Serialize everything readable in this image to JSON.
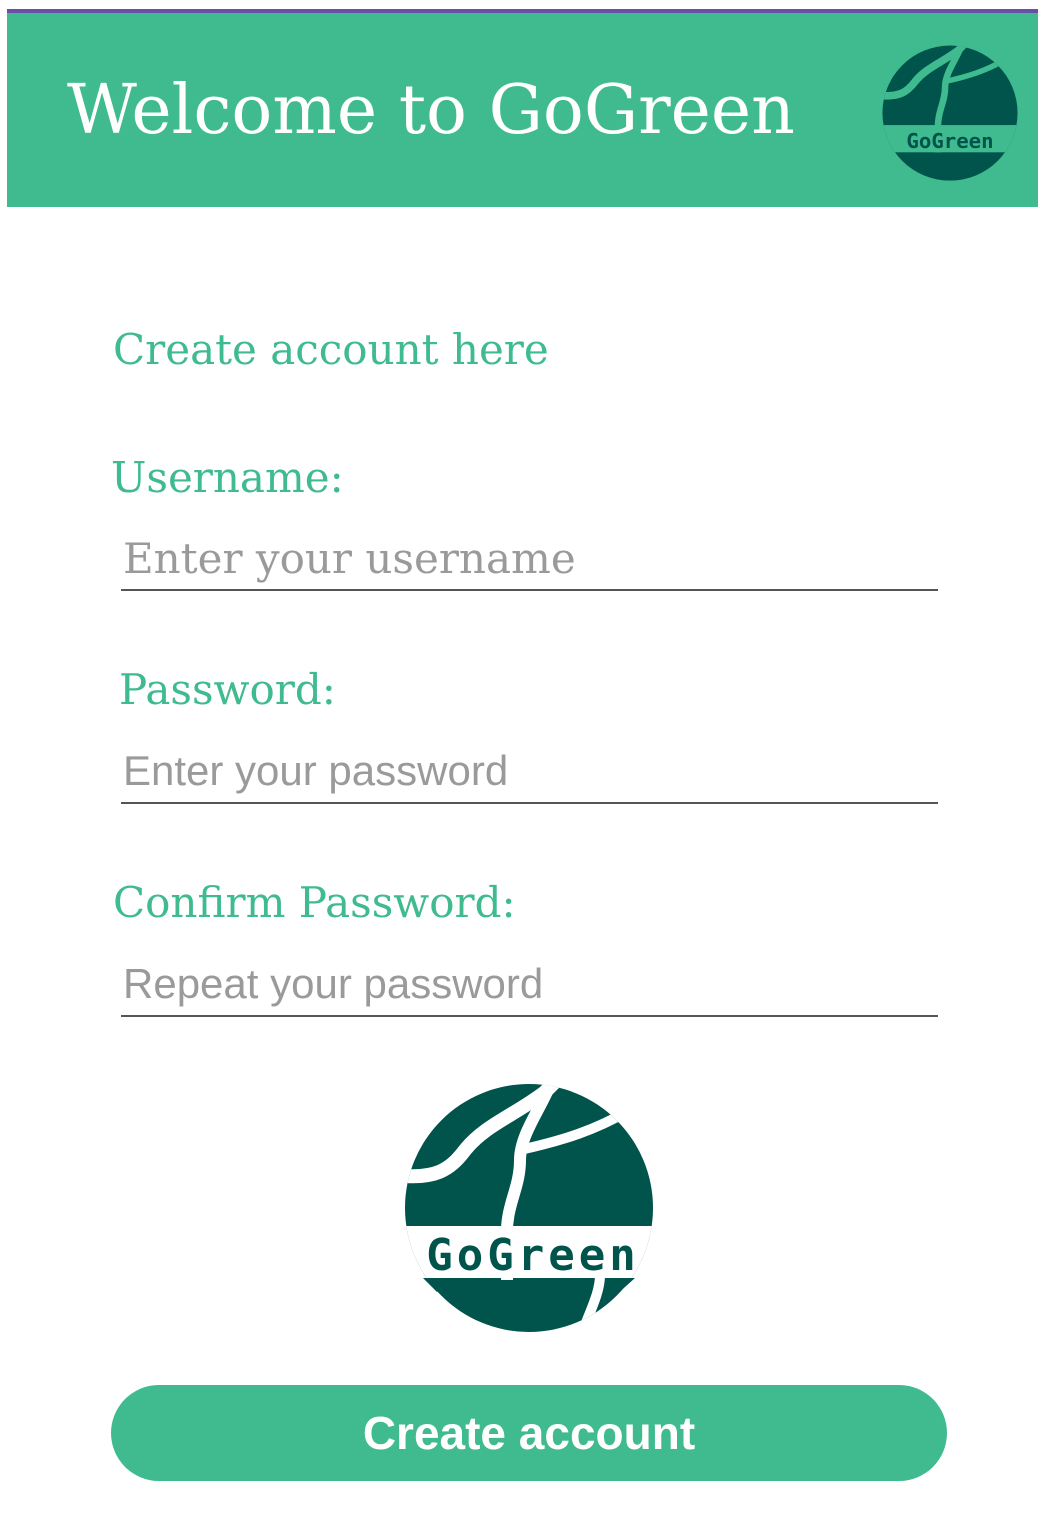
{
  "header": {
    "title": "Welcome to GoGreen",
    "logo_text": "GoGreen"
  },
  "form": {
    "section_title": "Create account here",
    "username": {
      "label": "Username:",
      "placeholder": "Enter your username",
      "value": ""
    },
    "password": {
      "label": "Password:",
      "placeholder": "Enter your password",
      "value": ""
    },
    "confirm_password": {
      "label": "Confirm Password:",
      "placeholder": "Repeat your password",
      "value": ""
    },
    "submit_label": "Create account"
  },
  "logo": {
    "text": "GoGreen",
    "icon": "gogreen-globe-logo"
  },
  "colors": {
    "brand_green": "#3fbb8f",
    "logo_dark_green": "#00544b",
    "status_bar_accent": "#6a4fa8"
  }
}
